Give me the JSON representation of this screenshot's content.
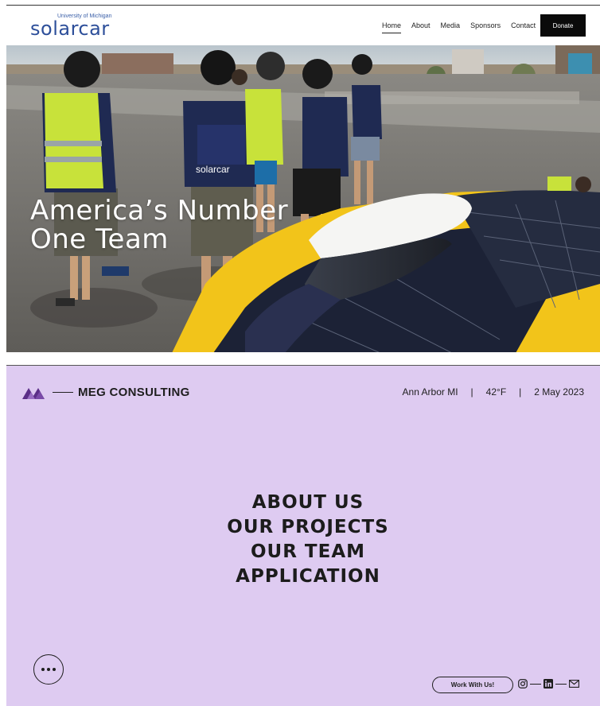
{
  "solarcar": {
    "logo_small": "University of Michigan",
    "logo_main": "solarcar",
    "nav": [
      {
        "label": "Home",
        "active": true
      },
      {
        "label": "About"
      },
      {
        "label": "Media"
      },
      {
        "label": "Sponsors"
      },
      {
        "label": "Contact"
      }
    ],
    "donate_label": "Donate",
    "hero_title_line1": "America’s Number",
    "hero_title_line2": "One Team",
    "shirt_text": "solarcar",
    "colors": {
      "brand_blue": "#2d4f9a",
      "car_yellow": "#f2c41a",
      "navy_shirt": "#1f2a52"
    }
  },
  "meg": {
    "brand_name": "MEG CONSULTING",
    "location": "Ann Arbor MI",
    "temperature": "42°F",
    "date": "2 May 2023",
    "separator": "|",
    "menu": [
      "ABOUT US",
      "OUR PROJECTS",
      "OUR TEAM",
      "APPLICATION"
    ],
    "work_button": "Work With Us!",
    "icons": [
      "menu-dots-icon",
      "instagram-icon",
      "linkedin-icon",
      "mail-icon"
    ],
    "colors": {
      "background": "#decbf1",
      "mark": "#5b2f87",
      "text": "#1e1e1e"
    }
  }
}
